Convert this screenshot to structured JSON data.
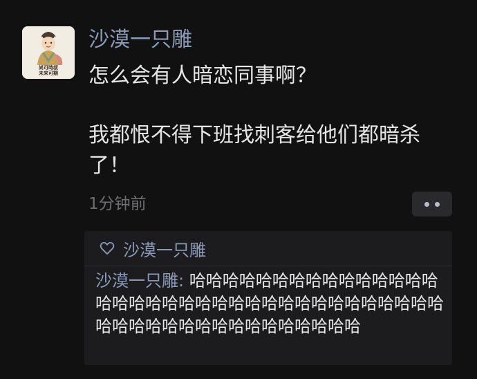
{
  "post": {
    "author": "沙漠一只雕",
    "avatar_text_line1": "尚可時叔",
    "avatar_text_line2": "未来可期",
    "content_line1": "怎么会有人暗恋同事啊？",
    "content_line2": "我都恨不得下班找刺客给他们都暗杀了！",
    "time": "1分钟前"
  },
  "likes": {
    "names": "沙漠一只雕"
  },
  "reply": {
    "author": "沙漠一只雕",
    "separator": ": ",
    "text": "哈哈哈哈哈哈哈哈哈哈哈哈哈哈哈哈哈哈哈哈哈哈哈哈哈哈哈哈哈哈哈哈哈哈哈哈哈哈哈哈哈哈哈哈哈哈哈哈哈哈哈哈"
  },
  "colors": {
    "background": "#111112",
    "name": "#8a9ab8",
    "text": "#e6e6e6",
    "muted": "#6f6f72",
    "panel": "#1c1c1e"
  },
  "icons": {
    "likes": "heart-outline-icon",
    "more": "more-dots-icon"
  }
}
